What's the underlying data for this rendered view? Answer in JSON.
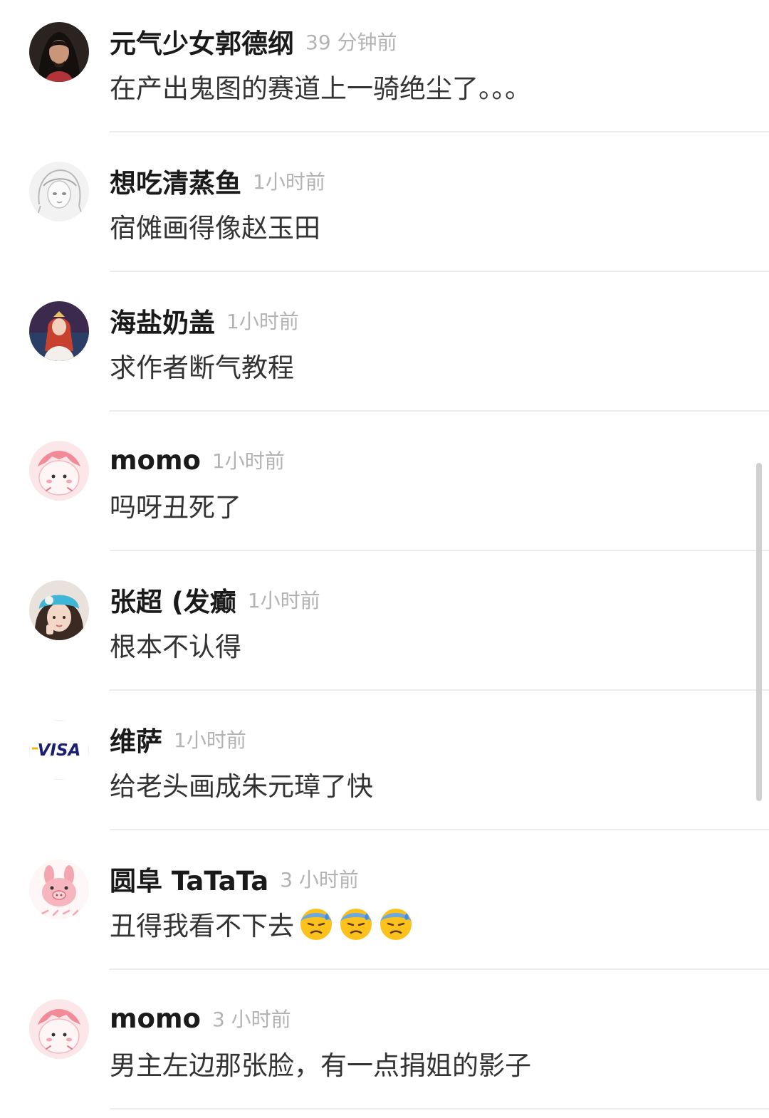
{
  "colors": {
    "username": "#1a1a1a",
    "timestamp": "#b3b3b3",
    "text": "#333333",
    "divider": "#ececec",
    "scrollbar": "#d0d0d0"
  },
  "comments": [
    {
      "username": "元气少女郭德纲",
      "time": "39 分钟前",
      "text": "在产出鬼图的赛道上一骑绝尘了。。。",
      "avatar": "dark-portrait-avatar"
    },
    {
      "username": "想吃清蒸鱼",
      "time": "1小时前",
      "text": "宿傩画得像赵玉田",
      "avatar": "sketch-girl-avatar"
    },
    {
      "username": "海盐奶盖",
      "time": "1小时前",
      "text": "求作者断气教程",
      "avatar": "princess-avatar"
    },
    {
      "username": "momo",
      "time": "1小时前",
      "text": "吗呀丑死了",
      "avatar": "pink-creature-avatar"
    },
    {
      "username": "张超 (发癫",
      "time": "1小时前",
      "text": "根本不认得",
      "avatar": "girl-blue-hat-avatar"
    },
    {
      "username": "维萨",
      "time": "1小时前",
      "text": "给老头画成朱元璋了快",
      "avatar": "visa-logo-avatar",
      "avatar_text": "VISA"
    },
    {
      "username": "圆阜 TaTaTa",
      "time": "3 小时前",
      "text": "丑得我看不下去",
      "avatar": "pink-bunny-avatar",
      "emoji": [
        "downcast-sweat-face-emoji",
        "downcast-sweat-face-emoji",
        "downcast-sweat-face-emoji"
      ]
    },
    {
      "username": "momo",
      "time": "3 小时前",
      "text": "男主左边那张脸，有一点捐姐的影子",
      "avatar": "pink-creature-avatar"
    }
  ]
}
